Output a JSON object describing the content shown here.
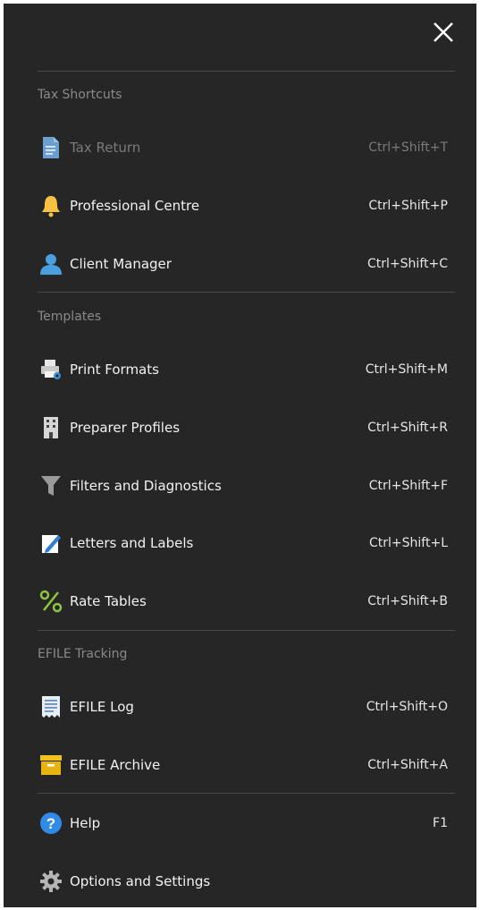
{
  "close_icon": "close-icon",
  "sections": {
    "tax_shortcuts": "Tax Shortcuts",
    "templates": "Templates",
    "efile_tracking": "EFILE Tracking"
  },
  "items": [
    {
      "label": "Tax Return",
      "shortcut": "Ctrl+Shift+T",
      "icon": "document-icon",
      "disabled": true
    },
    {
      "label": "Professional Centre",
      "shortcut": "Ctrl+Shift+P",
      "icon": "bell-icon"
    },
    {
      "label": "Client Manager",
      "shortcut": "Ctrl+Shift+C",
      "icon": "person-icon"
    },
    {
      "label": "Print Formats",
      "shortcut": "Ctrl+Shift+M",
      "icon": "printer-icon"
    },
    {
      "label": "Preparer Profiles",
      "shortcut": "Ctrl+Shift+R",
      "icon": "building-icon"
    },
    {
      "label": "Filters and Diagnostics",
      "shortcut": "Ctrl+Shift+F",
      "icon": "filter-icon"
    },
    {
      "label": "Letters and Labels",
      "shortcut": "Ctrl+Shift+L",
      "icon": "pen-icon"
    },
    {
      "label": "Rate Tables",
      "shortcut": "Ctrl+Shift+B",
      "icon": "percent-icon"
    },
    {
      "label": "EFILE Log",
      "shortcut": "Ctrl+Shift+O",
      "icon": "receipt-icon"
    },
    {
      "label": "EFILE Archive",
      "shortcut": "Ctrl+Shift+A",
      "icon": "archive-box-icon"
    },
    {
      "label": "Help",
      "shortcut": "F1",
      "icon": "help-icon"
    },
    {
      "label": "Options and Settings",
      "shortcut": "",
      "icon": "gear-icon"
    }
  ],
  "colors": {
    "background": "#262626",
    "divider": "#4a4a4a",
    "bell": "#f5c242",
    "person": "#4a9fe0",
    "percent": "#8dc63f",
    "archive": "#f0c419",
    "help": "#2f8be6"
  }
}
